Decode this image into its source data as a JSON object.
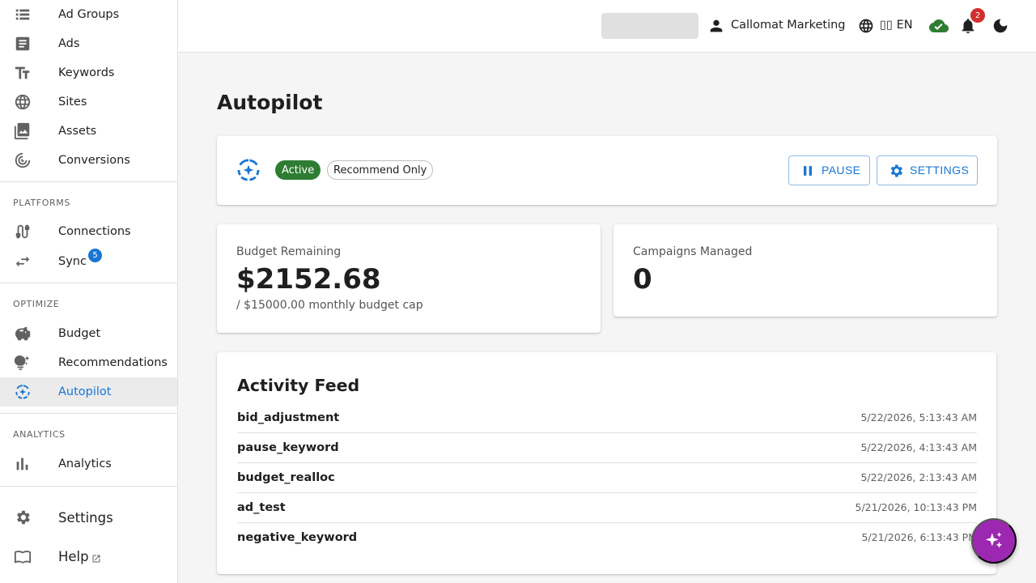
{
  "sidebar": {
    "nav_top": [
      {
        "label": "Ad Groups",
        "icon": "list-icon"
      },
      {
        "label": "Ads",
        "icon": "article-icon"
      },
      {
        "label": "Keywords",
        "icon": "text-fields-icon"
      },
      {
        "label": "Sites",
        "icon": "globe-icon"
      },
      {
        "label": "Assets",
        "icon": "image-icon"
      },
      {
        "label": "Conversions",
        "icon": "target-icon"
      }
    ],
    "platforms_title": "PLATFORMS",
    "platforms": [
      {
        "label": "Connections",
        "icon": "cable-icon"
      },
      {
        "label": "Sync",
        "icon": "sync-arrows-icon",
        "badge": "5"
      }
    ],
    "optimize_title": "OPTIMIZE",
    "optimize": [
      {
        "label": "Budget",
        "icon": "piggy-bank-icon"
      },
      {
        "label": "Recommendations",
        "icon": "lightbulb-icon"
      },
      {
        "label": "Autopilot",
        "icon": "autopilot-icon",
        "active": true
      }
    ],
    "analytics_title": "ANALYTICS",
    "analytics": [
      {
        "label": "Analytics",
        "icon": "bar-chart-icon"
      }
    ],
    "settings_label": "Settings",
    "help_label": "Help"
  },
  "topbar": {
    "user_name": "Callomat Marketing",
    "language": "▯▯ EN",
    "notifications_count": "2"
  },
  "page": {
    "title": "Autopilot",
    "status": {
      "active_label": "Active",
      "mode_label": "Recommend Only",
      "pause_label": "PAUSE",
      "settings_label": "SETTINGS"
    },
    "budget": {
      "label": "Budget Remaining",
      "value": "$2152.68",
      "sub": "/ $15000.00 monthly budget cap"
    },
    "campaigns": {
      "label": "Campaigns Managed",
      "value": "0"
    },
    "feed": {
      "title": "Activity Feed",
      "rows": [
        {
          "name": "bid_adjustment",
          "time": "5/22/2026, 5:13:43 AM"
        },
        {
          "name": "pause_keyword",
          "time": "5/22/2026, 4:13:43 AM"
        },
        {
          "name": "budget_realloc",
          "time": "5/22/2026, 2:13:43 AM"
        },
        {
          "name": "ad_test",
          "time": "5/21/2026, 10:13:43 PM"
        },
        {
          "name": "negative_keyword",
          "time": "5/21/2026, 6:13:43 PM"
        }
      ]
    }
  },
  "colors": {
    "primary": "#1976d2",
    "active_green": "#2e7d32",
    "badge_red": "#d32f2f",
    "fab_purple": "#9c27b0"
  }
}
